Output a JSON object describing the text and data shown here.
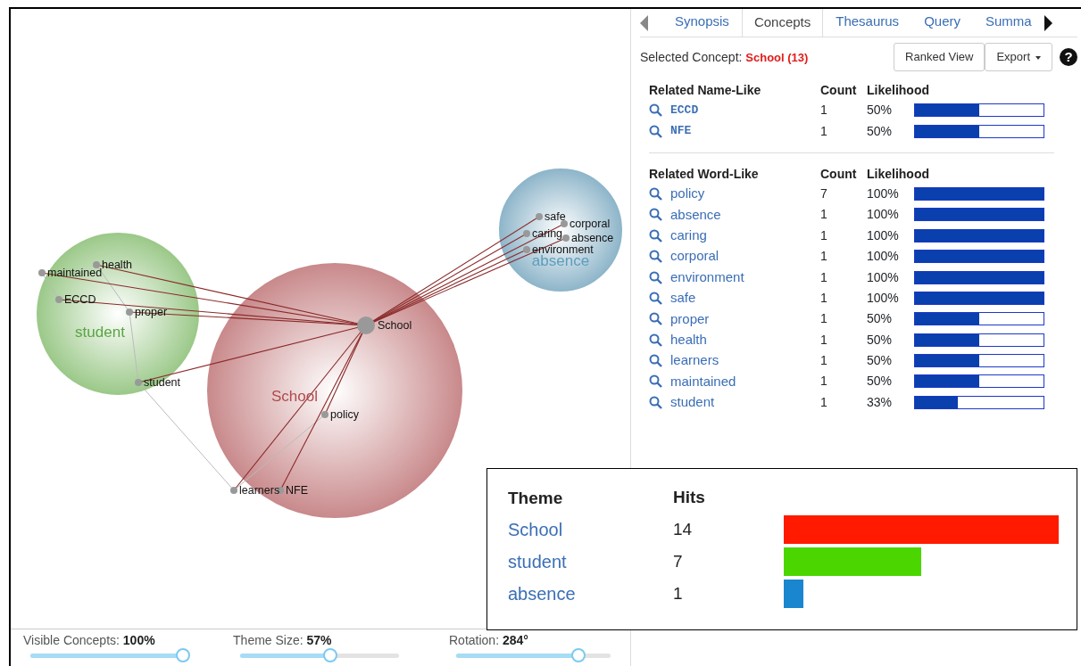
{
  "map": {
    "themes": [
      {
        "label": "School",
        "color": "#c98a8c"
      },
      {
        "label": "student",
        "color": "#9cc98a"
      },
      {
        "label": "absence",
        "color": "#8fb6ca"
      }
    ],
    "concepts": [
      {
        "label": "School"
      },
      {
        "label": "health"
      },
      {
        "label": "maintained"
      },
      {
        "label": "ECCD"
      },
      {
        "label": "proper"
      },
      {
        "label": "student"
      },
      {
        "label": "policy"
      },
      {
        "label": "learners"
      },
      {
        "label": "NFE"
      },
      {
        "label": "safe"
      },
      {
        "label": "corporal"
      },
      {
        "label": "caring"
      },
      {
        "label": "absence"
      },
      {
        "label": "environment"
      }
    ]
  },
  "sliders": [
    {
      "label": "Visible Concepts:",
      "reading": "100%",
      "level": 1.0
    },
    {
      "label": "Theme Size:",
      "reading": "57%",
      "level": 0.57
    },
    {
      "label": "Rotation:",
      "reading": "284°",
      "level": 0.79
    }
  ],
  "tabs": [
    {
      "label": "Synopsis",
      "selected": false
    },
    {
      "label": "Concepts",
      "selected": true
    },
    {
      "label": "Thesaurus",
      "selected": false
    },
    {
      "label": "Query",
      "selected": false
    },
    {
      "label": "Summa",
      "selected": false
    }
  ],
  "selected_concept": {
    "label": "Selected Concept:",
    "value": "School (13)"
  },
  "buttons": [
    {
      "label": "Ranked View",
      "kind": "plain"
    },
    {
      "label": "Export",
      "kind": "dropdown"
    }
  ],
  "help": "?",
  "name_like": {
    "columns": [
      "Related Name-Like",
      "Count",
      "Likelihood"
    ],
    "rows": [
      {
        "term": "ECCD",
        "count": "1",
        "likelihood": "50%",
        "level": 0.5
      },
      {
        "term": "NFE",
        "count": "1",
        "likelihood": "50%",
        "level": 0.5
      }
    ]
  },
  "word_like": {
    "columns": [
      "Related Word-Like",
      "Count",
      "Likelihood"
    ],
    "rows": [
      {
        "term": "policy",
        "count": "7",
        "likelihood": "100%",
        "level": 1.0
      },
      {
        "term": "absence",
        "count": "1",
        "likelihood": "100%",
        "level": 1.0
      },
      {
        "term": "caring",
        "count": "1",
        "likelihood": "100%",
        "level": 1.0
      },
      {
        "term": "corporal",
        "count": "1",
        "likelihood": "100%",
        "level": 1.0
      },
      {
        "term": "environment",
        "count": "1",
        "likelihood": "100%",
        "level": 1.0
      },
      {
        "term": "safe",
        "count": "1",
        "likelihood": "100%",
        "level": 1.0
      },
      {
        "term": "proper",
        "count": "1",
        "likelihood": "50%",
        "level": 0.5
      },
      {
        "term": "health",
        "count": "1",
        "likelihood": "50%",
        "level": 0.5
      },
      {
        "term": "learners",
        "count": "1",
        "likelihood": "50%",
        "level": 0.5
      },
      {
        "term": "maintained",
        "count": "1",
        "likelihood": "50%",
        "level": 0.5
      },
      {
        "term": "student",
        "count": "1",
        "likelihood": "33%",
        "level": 0.33
      }
    ]
  },
  "theme_legend": {
    "columns": [
      "Theme",
      "Hits"
    ],
    "rows": [
      {
        "theme": "School",
        "hits": "14",
        "color": "#ff1a00"
      },
      {
        "theme": "student",
        "hits": "7",
        "color": "#4cd600"
      },
      {
        "theme": "absence",
        "hits": "1",
        "color": "#1a86d0"
      }
    ]
  }
}
